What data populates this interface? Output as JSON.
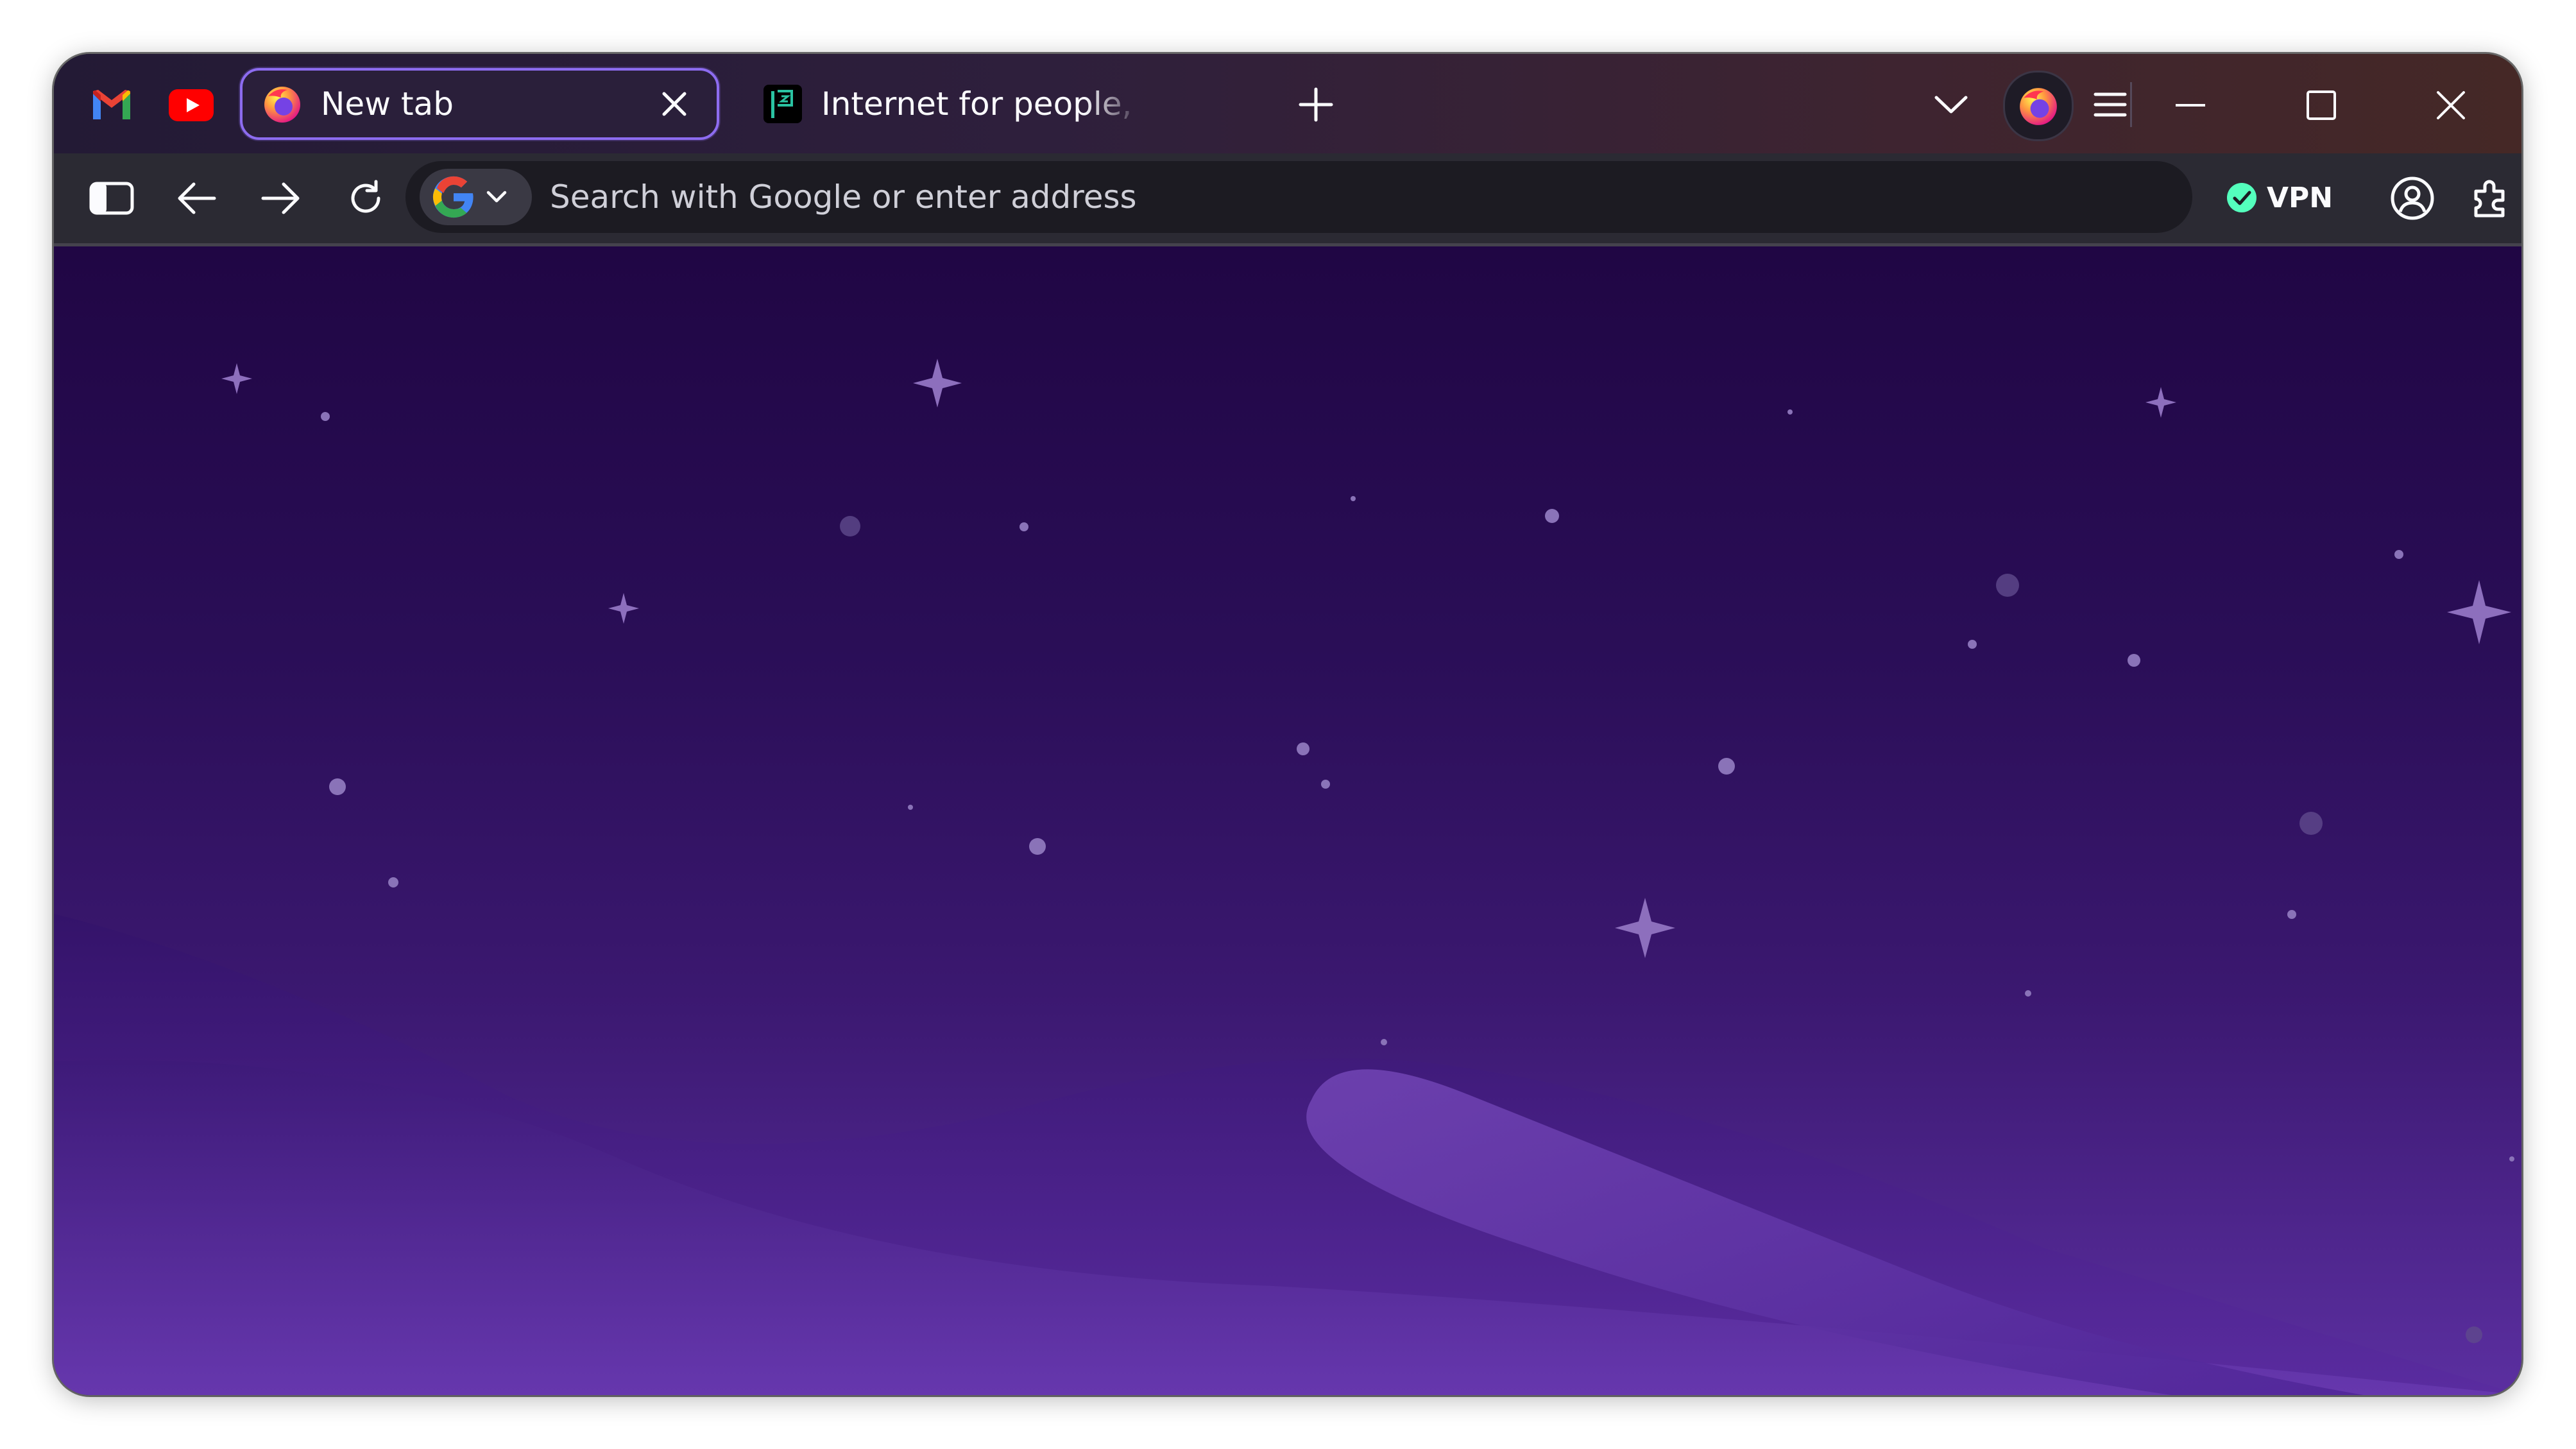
{
  "browser": "Firefox",
  "pinned_tabs": [
    {
      "name": "Gmail",
      "icon": "gmail-icon"
    },
    {
      "name": "YouTube",
      "icon": "youtube-icon"
    }
  ],
  "tabs": [
    {
      "title": "New tab",
      "icon": "firefox-icon",
      "active": true
    },
    {
      "title": "Internet for people, not profit",
      "icon": "mozilla-flag-icon",
      "active": false
    }
  ],
  "toolbar": {
    "new_tab": "plus-icon",
    "tab_list": "chevron-down-icon",
    "account": "firefox-icon",
    "menu": "hamburger-menu-icon",
    "window_controls": [
      "minimize-icon",
      "maximize-icon",
      "close-icon"
    ]
  },
  "nav": {
    "sidebar": "sidebar-icon",
    "back": "back-arrow-icon",
    "forward": "forward-arrow-icon",
    "reload": "reload-icon",
    "search_engine": "google-icon",
    "placeholder": "Search with Google or enter address",
    "vpn_label": "VPN",
    "vpn_status_icon": "check-circle-icon",
    "profile": "account-icon",
    "extensions": "puzzle-icon"
  },
  "colors": {
    "accent": "#8d6cf0",
    "vpn_ok": "#54ffbd",
    "content_top": "#200644",
    "content_bottom": "#5b2fa0"
  }
}
